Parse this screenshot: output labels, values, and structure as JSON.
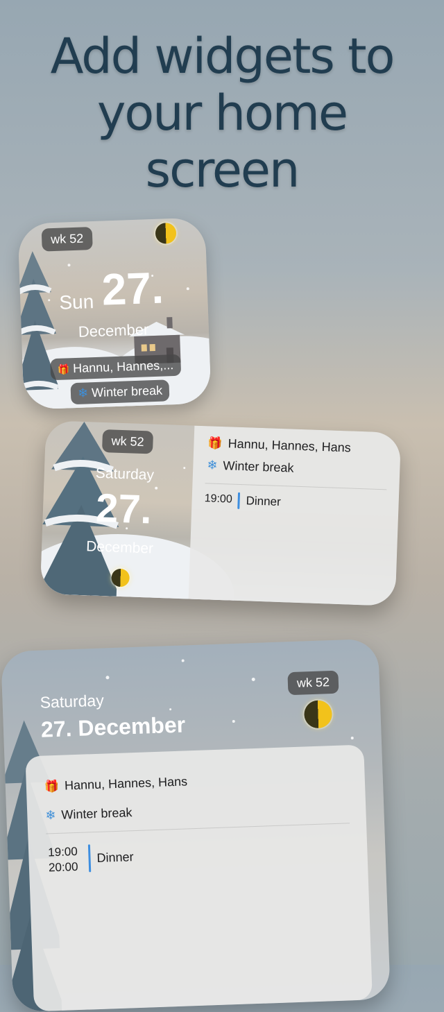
{
  "headline": [
    "Add widgets to",
    "your home",
    "screen"
  ],
  "widget_small": {
    "week": "wk 52",
    "weekday": "Sun",
    "day": "27.",
    "month": "December",
    "event1": "Hannu, Hannes,...",
    "event2": "Winter break"
  },
  "widget_medium": {
    "week": "wk 52",
    "weekday": "Saturday",
    "day": "27.",
    "month": "December",
    "names": "Hannu, Hannes, Hans",
    "holiday": "Winter break",
    "event_time": "19:00",
    "event_title": "Dinner"
  },
  "widget_large": {
    "week": "wk 52",
    "weekday": "Saturday",
    "date": "27. December",
    "names": "Hannu, Hannes, Hans",
    "holiday": "Winter break",
    "event_start": "19:00",
    "event_end": "20:00",
    "event_title": "Dinner"
  },
  "icons": {
    "gift": "gift-icon",
    "snowflake": "snowflake-icon",
    "moon": "moon-phase-icon"
  },
  "colors": {
    "headline": "#213d50",
    "event_bar": "#3d8ee0",
    "moon_light": "#f2c21b"
  }
}
